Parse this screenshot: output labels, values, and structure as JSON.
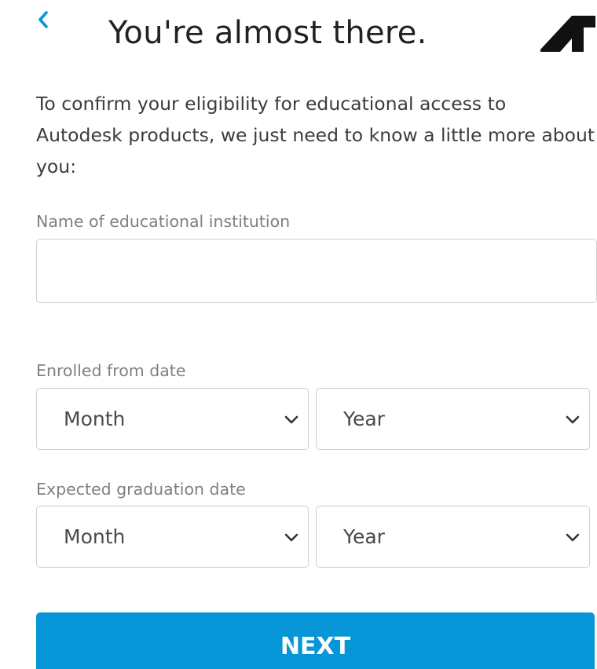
{
  "header": {
    "title": "You're almost there.",
    "back_icon": "chevron-left-icon",
    "logo_icon": "autodesk-logo-icon"
  },
  "intro_text": "To confirm your eligibility for educational access to Autodesk products, we just need to know a little more about you:",
  "institution": {
    "label": "Name of educational institution",
    "value": "",
    "placeholder": ""
  },
  "enrolled": {
    "label": "Enrolled from date",
    "month": "Month",
    "year": "Year"
  },
  "graduation": {
    "label": "Expected graduation date",
    "month": "Month",
    "year": "Year"
  },
  "next_button": "NEXT",
  "colors": {
    "accent": "#0696d7",
    "label": "#808080",
    "text": "#3c3c3c",
    "border": "#cfcfcf"
  }
}
